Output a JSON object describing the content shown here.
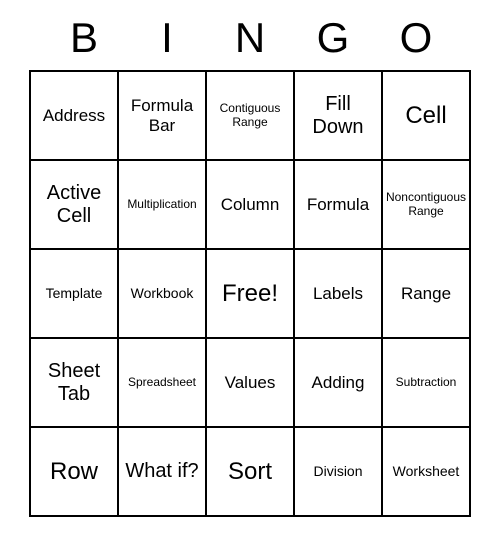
{
  "header": [
    "B",
    "I",
    "N",
    "G",
    "O"
  ],
  "cells": [
    [
      {
        "text": "Address",
        "size": "fs-m"
      },
      {
        "text": "Formula Bar",
        "size": "fs-m"
      },
      {
        "text": "Contiguous Range",
        "size": "fs-xs"
      },
      {
        "text": "Fill Down",
        "size": "fs-l"
      },
      {
        "text": "Cell",
        "size": "fs-xl"
      }
    ],
    [
      {
        "text": "Active Cell",
        "size": "fs-l"
      },
      {
        "text": "Multiplication",
        "size": "fs-xs"
      },
      {
        "text": "Column",
        "size": "fs-m"
      },
      {
        "text": "Formula",
        "size": "fs-m"
      },
      {
        "text": "Noncontiguous Range",
        "size": "fs-xs"
      }
    ],
    [
      {
        "text": "Template",
        "size": "fs-s"
      },
      {
        "text": "Workbook",
        "size": "fs-s"
      },
      {
        "text": "Free!",
        "size": "fs-xl"
      },
      {
        "text": "Labels",
        "size": "fs-m"
      },
      {
        "text": "Range",
        "size": "fs-m"
      }
    ],
    [
      {
        "text": "Sheet Tab",
        "size": "fs-l"
      },
      {
        "text": "Spreadsheet",
        "size": "fs-xs"
      },
      {
        "text": "Values",
        "size": "fs-m"
      },
      {
        "text": "Adding",
        "size": "fs-m"
      },
      {
        "text": "Subtraction",
        "size": "fs-xs"
      }
    ],
    [
      {
        "text": "Row",
        "size": "fs-xl"
      },
      {
        "text": "What if?",
        "size": "fs-l"
      },
      {
        "text": "Sort",
        "size": "fs-xl"
      },
      {
        "text": "Division",
        "size": "fs-s"
      },
      {
        "text": "Worksheet",
        "size": "fs-s"
      }
    ]
  ]
}
